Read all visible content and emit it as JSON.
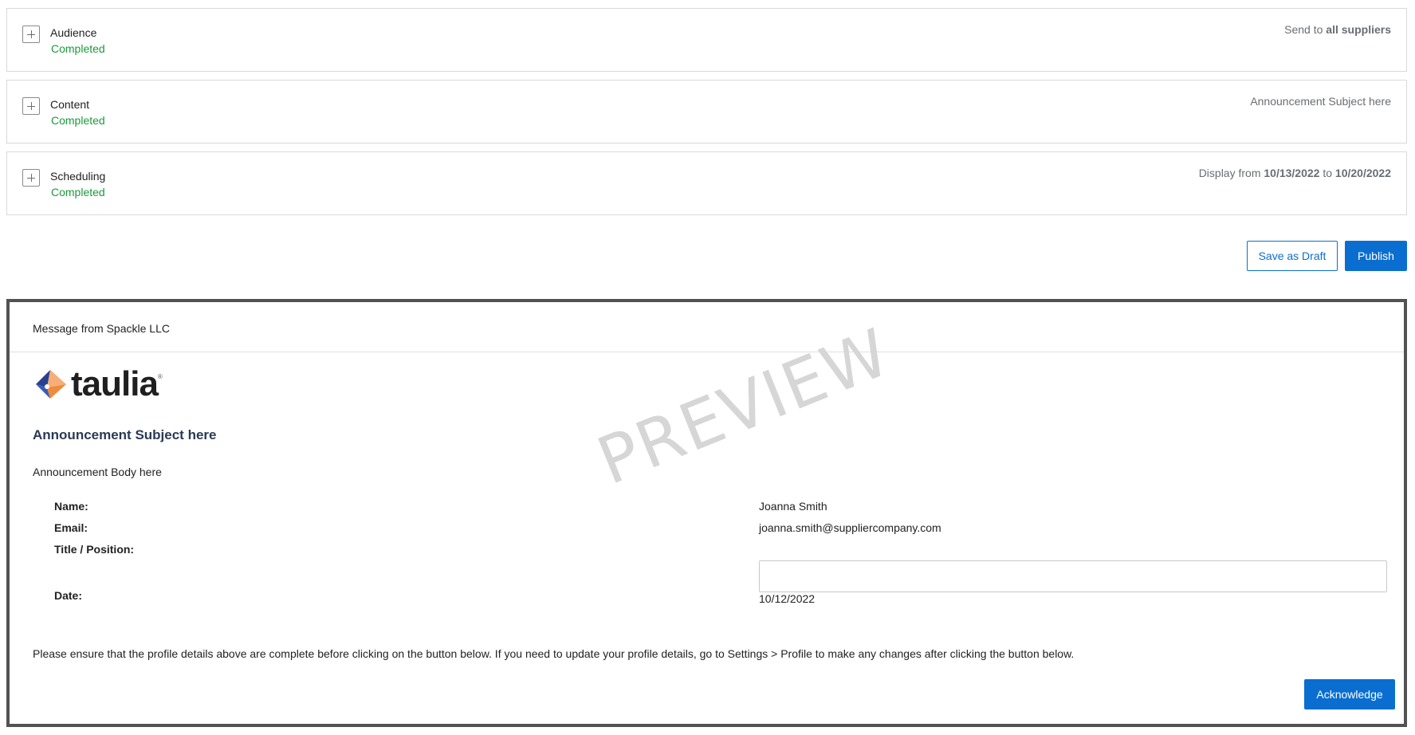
{
  "sections": [
    {
      "title": "Audience",
      "status": "Completed",
      "summary_prefix": "Send to ",
      "summary_bold": "all suppliers"
    },
    {
      "title": "Content",
      "status": "Completed",
      "summary_prefix": "Announcement Subject here"
    },
    {
      "title": "Scheduling",
      "status": "Completed",
      "summary_prefix": "Display from ",
      "summary_bold": "10/13/2022",
      "summary_mid": " to ",
      "summary_bold2": "10/20/2022"
    }
  ],
  "actions": {
    "save_draft": "Save as Draft",
    "publish": "Publish"
  },
  "preview": {
    "header": "Message from Spackle LLC",
    "logo_text": "taulia",
    "logo_mark": "®",
    "watermark": "PREVIEW",
    "subject": "Announcement Subject here",
    "body": "Announcement Body here",
    "fields": {
      "name_label": "Name:",
      "name_value": "Joanna Smith",
      "email_label": "Email:",
      "email_value": "joanna.smith@suppliercompany.com",
      "title_label": "Title / Position:",
      "title_value": "",
      "date_label": "Date:",
      "date_value": "10/12/2022"
    },
    "notice": "Please ensure that the profile details above are complete before clicking on the button below. If you need to update your profile details, go to Settings > Profile to make any changes after clicking the button below.",
    "acknowledge": "Acknowledge"
  },
  "colors": {
    "accent": "#0a6ed1",
    "completed": "#1a9a3c",
    "preview_border": "#525252"
  }
}
